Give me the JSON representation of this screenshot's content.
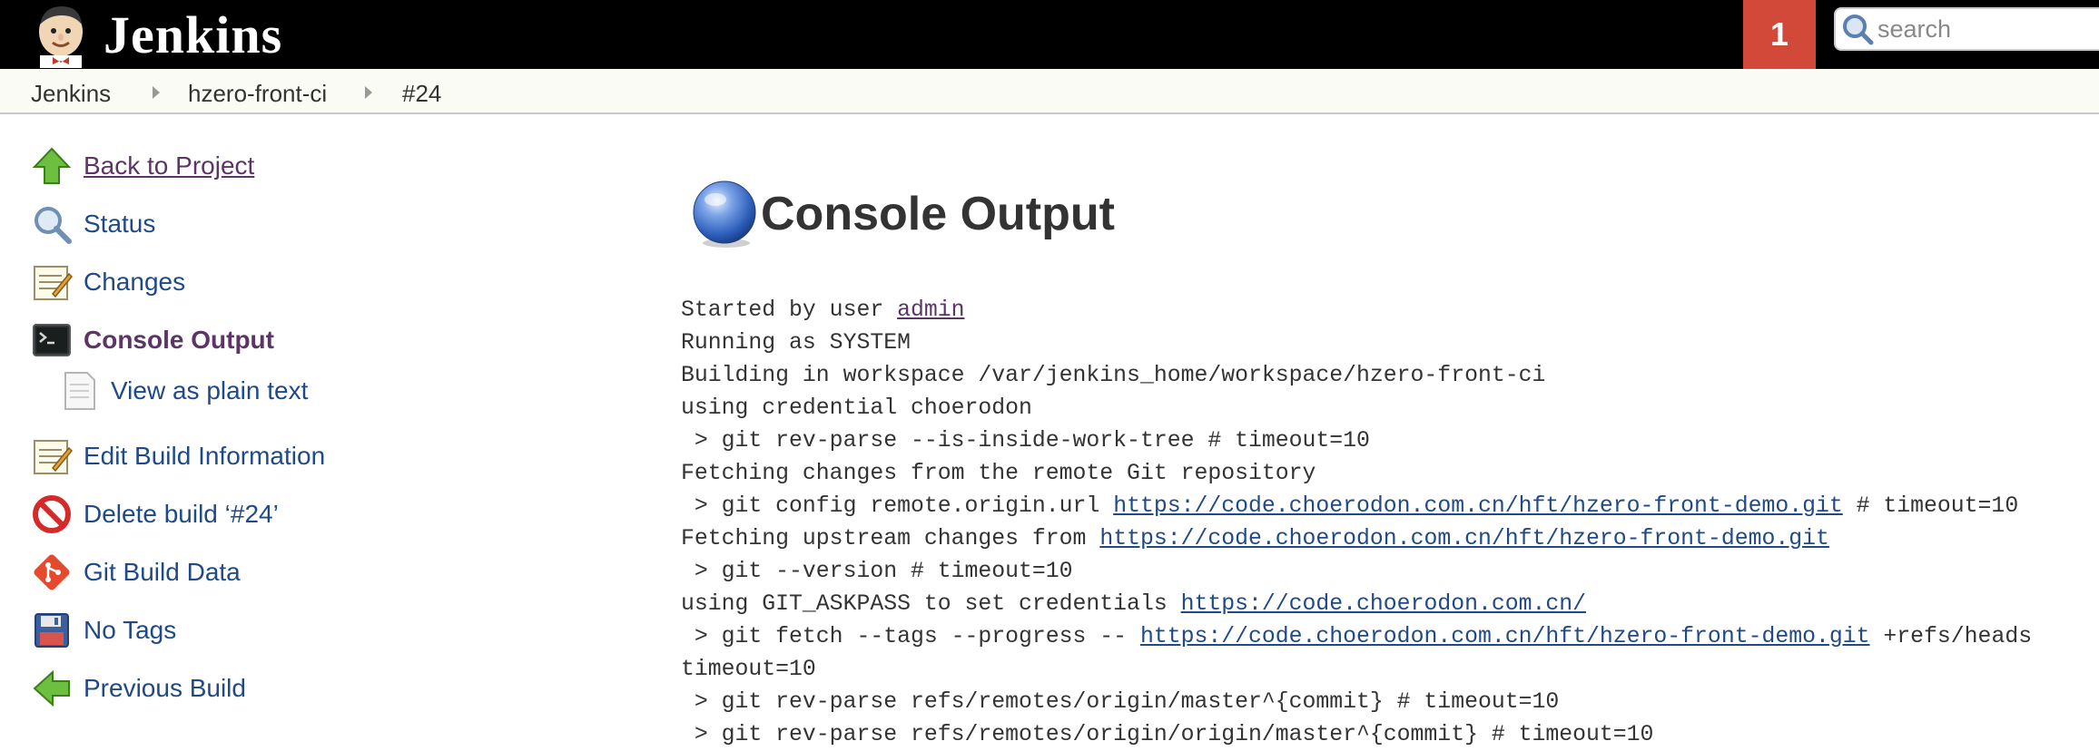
{
  "header": {
    "brand": "Jenkins",
    "notification_count": "1",
    "search_placeholder": "search",
    "colors": {
      "bar": "#000000",
      "notification": "#d24939"
    }
  },
  "breadcrumb": [
    "Jenkins",
    "hzero-front-ci",
    "#24"
  ],
  "sidebar": {
    "tasks": [
      {
        "label": "Back to Project",
        "icon": "up-arrow-icon"
      },
      {
        "label": "Status",
        "icon": "magnifier-icon"
      },
      {
        "label": "Changes",
        "icon": "notepad-icon"
      },
      {
        "label": "Console Output",
        "icon": "terminal-icon"
      },
      {
        "label": "View as plain text",
        "icon": "document-icon"
      },
      {
        "label": "Edit Build Information",
        "icon": "notepad-icon"
      },
      {
        "label": "Delete build ‘#24’",
        "icon": "no-entry-icon"
      },
      {
        "label": "Git Build Data",
        "icon": "git-icon"
      },
      {
        "label": "No Tags",
        "icon": "floppy-disk-icon"
      },
      {
        "label": "Previous Build",
        "icon": "left-arrow-icon"
      }
    ]
  },
  "main": {
    "title": "Console Output",
    "status_icon": "blue-ball-icon",
    "console": {
      "started_by_prefix": "Started by user ",
      "user": "admin",
      "running_as": "Running as SYSTEM",
      "workspace": "Building in workspace /var/jenkins_home/workspace/hzero-front-ci",
      "credential": "using credential choerodon",
      "cmd_is_inside": " > git rev-parse --is-inside-work-tree # timeout=10",
      "fetching_changes": "Fetching changes from the remote Git repository",
      "cmd_config_prefix": " > git config remote.origin.url ",
      "repo_url": "https://code.choerodon.com.cn/hft/hzero-front-demo.git",
      "timeout_suffix": " # timeout=10",
      "fetching_upstream_prefix": "Fetching upstream changes from ",
      "cmd_version": " > git --version # timeout=10",
      "askpass_prefix": "using GIT_ASKPASS to set credentials ",
      "askpass_url": "https://code.choerodon.com.cn/",
      "cmd_fetch_prefix": " > git fetch --tags --progress -- ",
      "cmd_fetch_suffix": " +refs/heads",
      "timeout_line": "timeout=10",
      "cmd_rev_master": " > git rev-parse refs/remotes/origin/master^{commit} # timeout=10",
      "cmd_rev_origin_master": " > git rev-parse refs/remotes/origin/origin/master^{commit} # timeout=10"
    }
  }
}
